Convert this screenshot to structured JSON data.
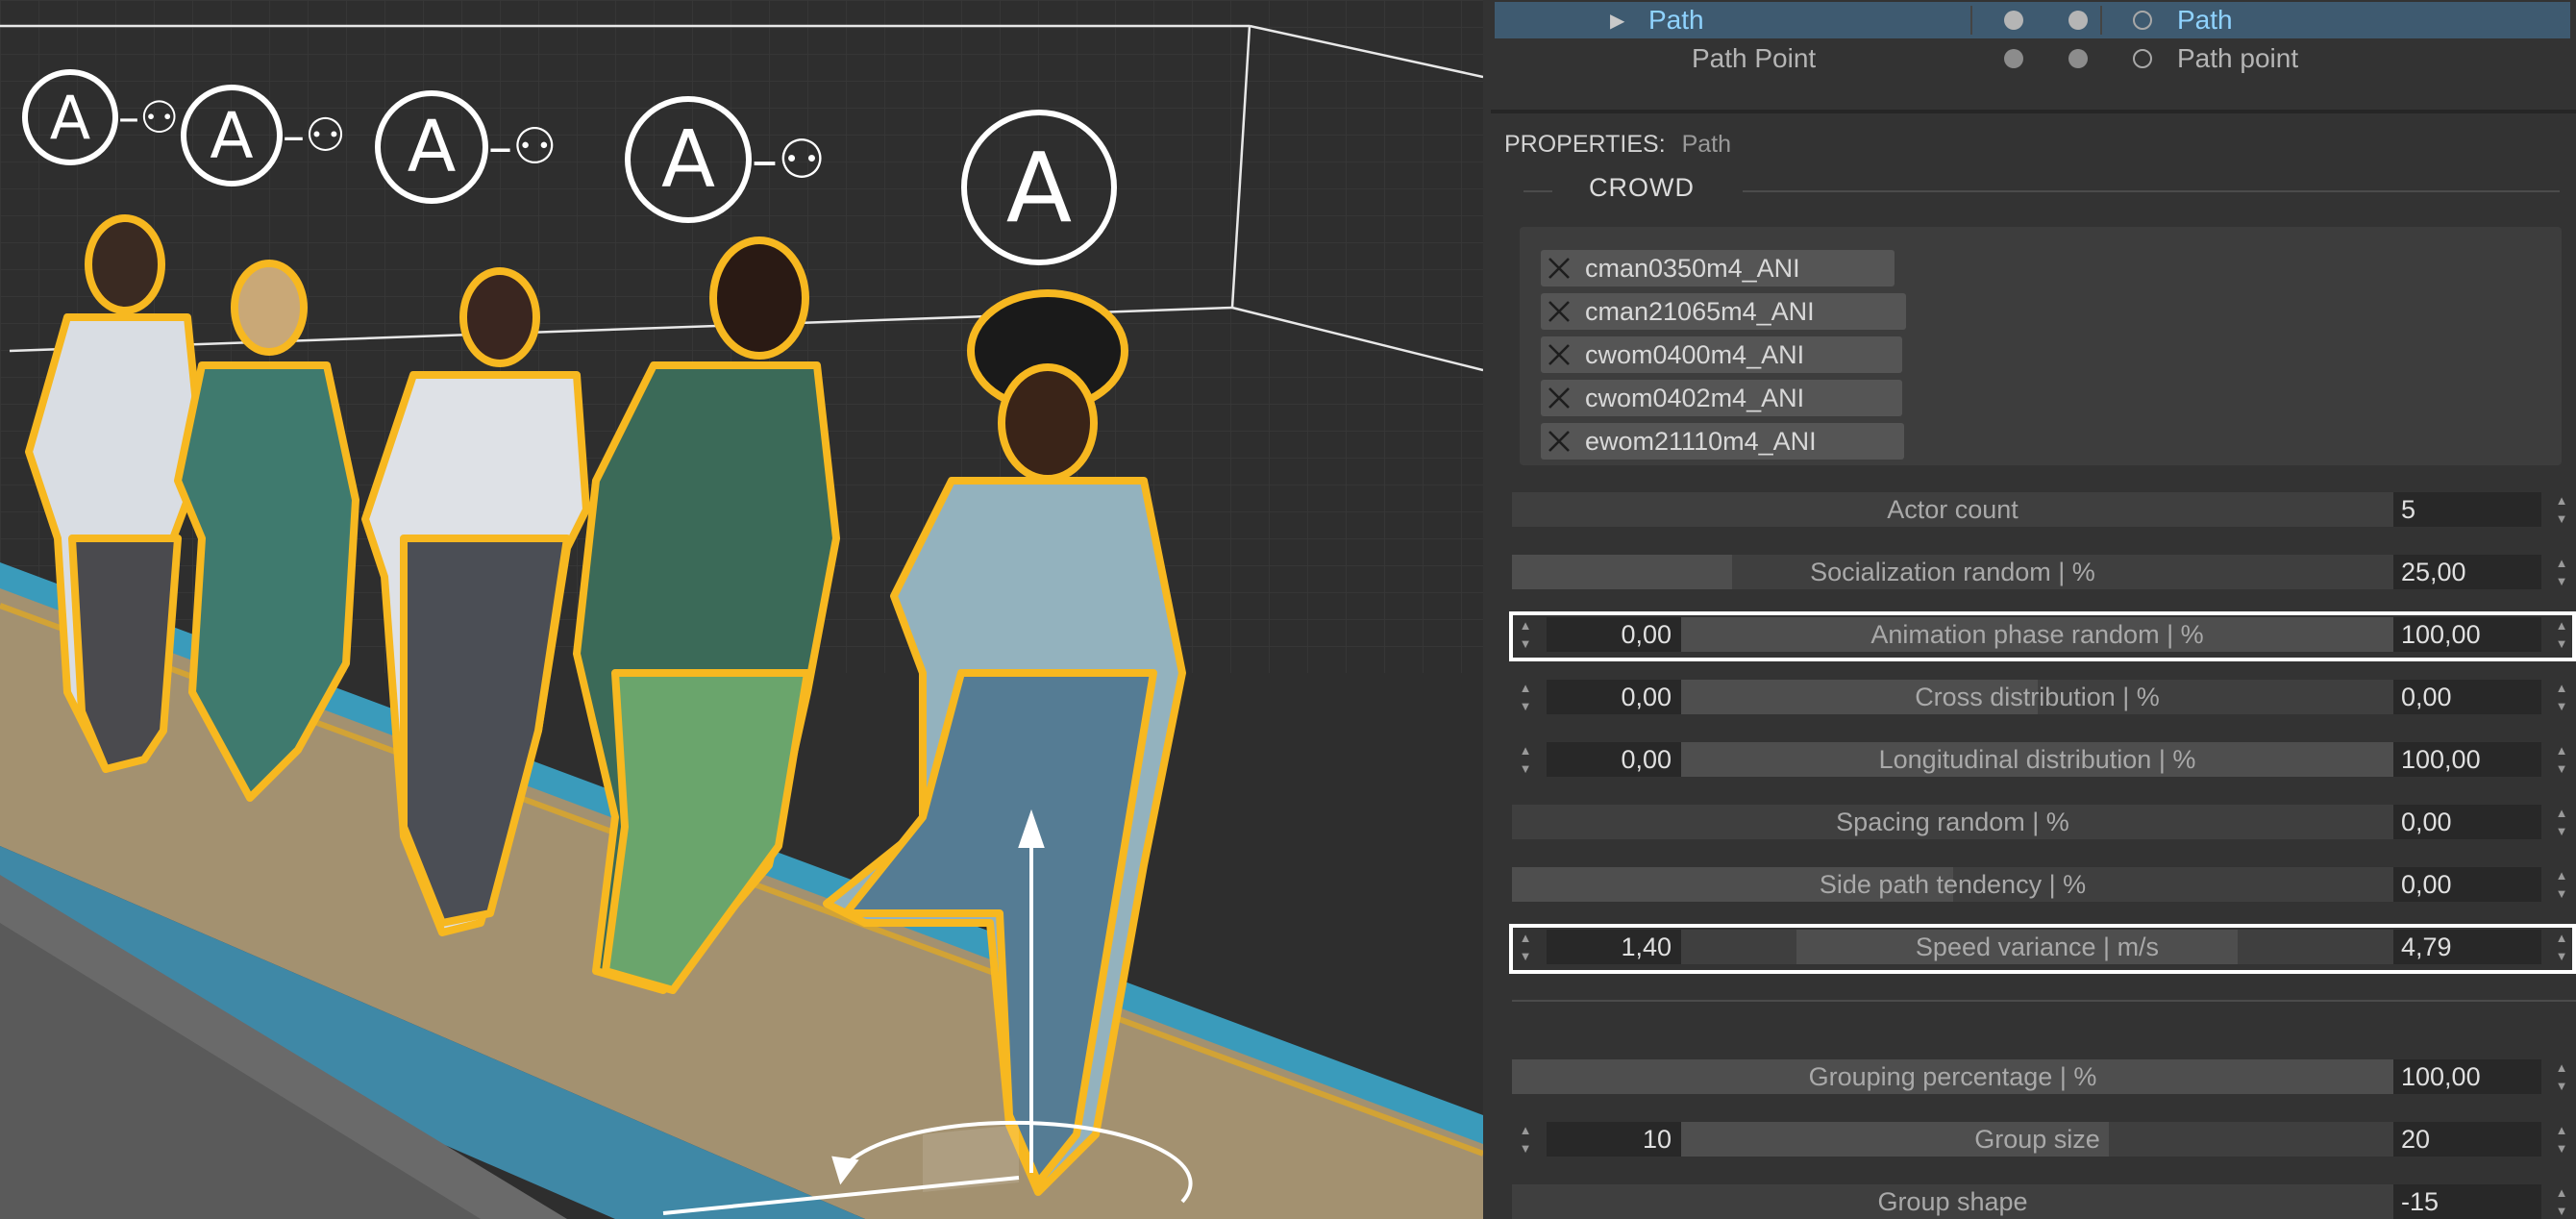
{
  "viewport": {
    "actor_badges": [
      {
        "letter": "A",
        "linked": true
      },
      {
        "letter": "A",
        "linked": true
      },
      {
        "letter": "A",
        "linked": true
      },
      {
        "letter": "A",
        "linked": true
      },
      {
        "letter": "A",
        "linked": false
      }
    ],
    "colors": {
      "outline": "#f7b820",
      "walkway": "#a39170",
      "edge_stripe": "#3a9bbb",
      "curb": "#d2a335"
    }
  },
  "outliner": {
    "rows": [
      {
        "name": "Path",
        "type": "Path",
        "selected": true,
        "expandable": true
      },
      {
        "name": "Path Point",
        "type": "Path point",
        "selected": false,
        "expandable": false
      }
    ]
  },
  "properties": {
    "label": "PROPERTIES:",
    "target": "Path",
    "section": "CROWD",
    "actors": [
      "cman0350m4_ANI",
      "cman21065m4_ANI",
      "cwom0400m4_ANI",
      "cwom0402m4_ANI",
      "ewom21110m4_ANI"
    ],
    "params": [
      {
        "label": "Actor count",
        "value": "5",
        "fill": 0.0
      },
      {
        "label": "Socialization random | %",
        "value": "25,00",
        "fill": 0.25
      },
      {
        "label": "Animation phase random | %",
        "min": "0,00",
        "value": "100,00",
        "fill": 1.0,
        "highlighted": true
      },
      {
        "label": "Cross distribution | %",
        "min": "0,00",
        "value": "0,00",
        "fill": 0.5
      },
      {
        "label": "Longitudinal distribution | %",
        "min": "0,00",
        "value": "100,00",
        "fill": 1.0
      },
      {
        "label": "Spacing random | %",
        "value": "0,00",
        "fill": 0.0
      },
      {
        "label": "Side path tendency | %",
        "value": "0,00",
        "fill": 0.5
      },
      {
        "label": "Speed variance | m/s",
        "min": "1,40",
        "value": "4,79",
        "fill": 0.62,
        "highlighted": true
      },
      {
        "label": "Grouping percentage | %",
        "value": "100,00",
        "fill": 1.0
      },
      {
        "label": "Group size",
        "min": "10",
        "value": "20",
        "fill": 0.6
      },
      {
        "label": "Group shape",
        "value": "-15",
        "fill": 0.0
      }
    ]
  }
}
